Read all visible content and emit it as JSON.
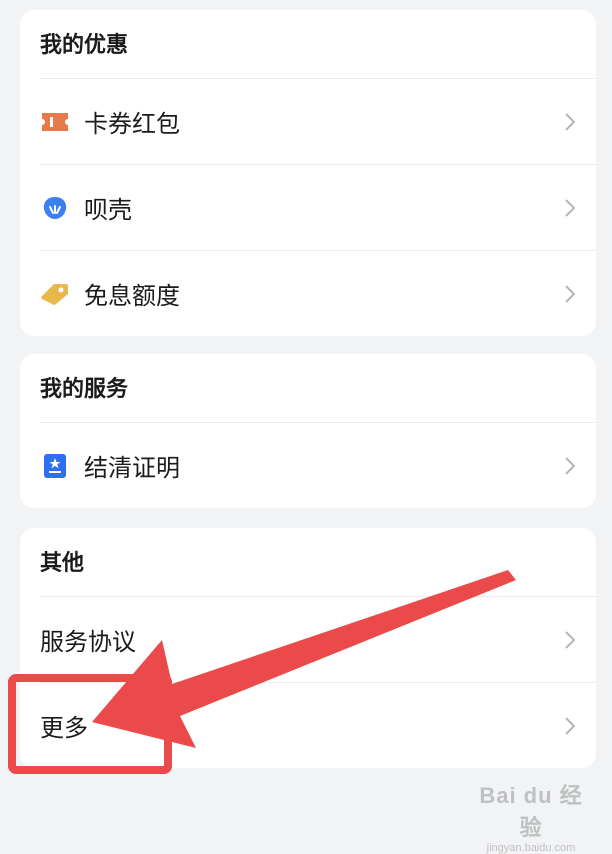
{
  "offers": {
    "title": "我的优惠",
    "items": [
      {
        "label": "卡券红包",
        "icon": "coupon-icon"
      },
      {
        "label": "呗壳",
        "icon": "shell-icon"
      },
      {
        "label": "免息额度",
        "icon": "price-tag-icon"
      }
    ]
  },
  "services": {
    "title": "我的服务",
    "items": [
      {
        "label": "结清证明",
        "icon": "certificate-icon"
      }
    ]
  },
  "other": {
    "title": "其他",
    "items": [
      {
        "label": "服务协议"
      },
      {
        "label": "更多"
      }
    ]
  },
  "colors": {
    "coupon": "#e8794a",
    "shell": "#3b7ff0",
    "tag": "#e8b84a",
    "certificate": "#2e6ff0",
    "annotation": "#ea4a4a"
  },
  "watermark": {
    "main": "Bai du 经验",
    "sub": "jingyan.baidu.com"
  }
}
